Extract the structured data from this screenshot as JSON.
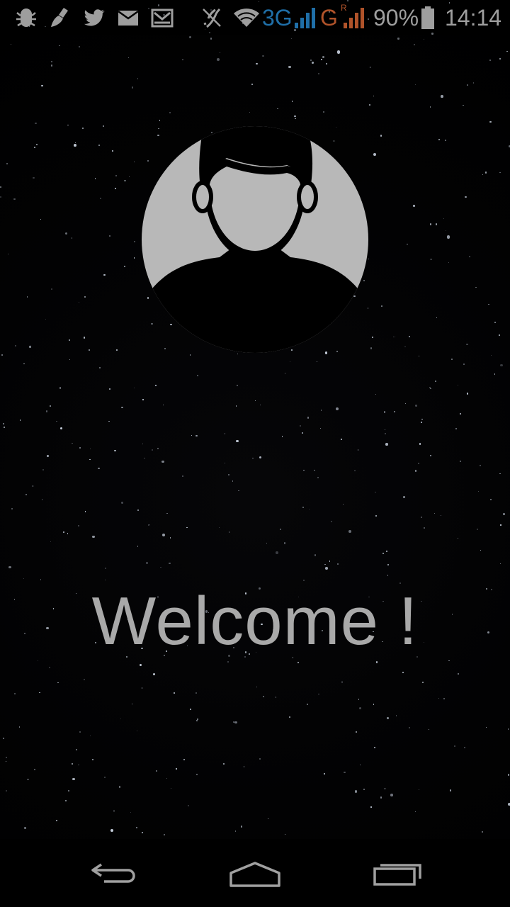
{
  "status_bar": {
    "network_3g": "3G",
    "network_g": "G",
    "roaming": "R",
    "battery": "90%",
    "time": "14:14",
    "icons": [
      "android-debug-icon",
      "cleaner-brush-icon",
      "twitter-icon",
      "gmail-icon",
      "email-icon",
      "muted-icon",
      "wifi-icon",
      "signal-3g-icon",
      "signal-g-icon",
      "battery-icon"
    ],
    "accent_blue": "#1f6fa8",
    "accent_orange": "#b0532a"
  },
  "main": {
    "welcome_text": "Welcome !",
    "avatar_icon": "user-avatar-icon"
  },
  "nav_bar": {
    "buttons": [
      "back-icon",
      "home-icon",
      "recent-apps-icon"
    ]
  },
  "colors": {
    "background": "#000000",
    "text": "#a9a9a9",
    "avatar_fill": "#b8b8b8"
  }
}
